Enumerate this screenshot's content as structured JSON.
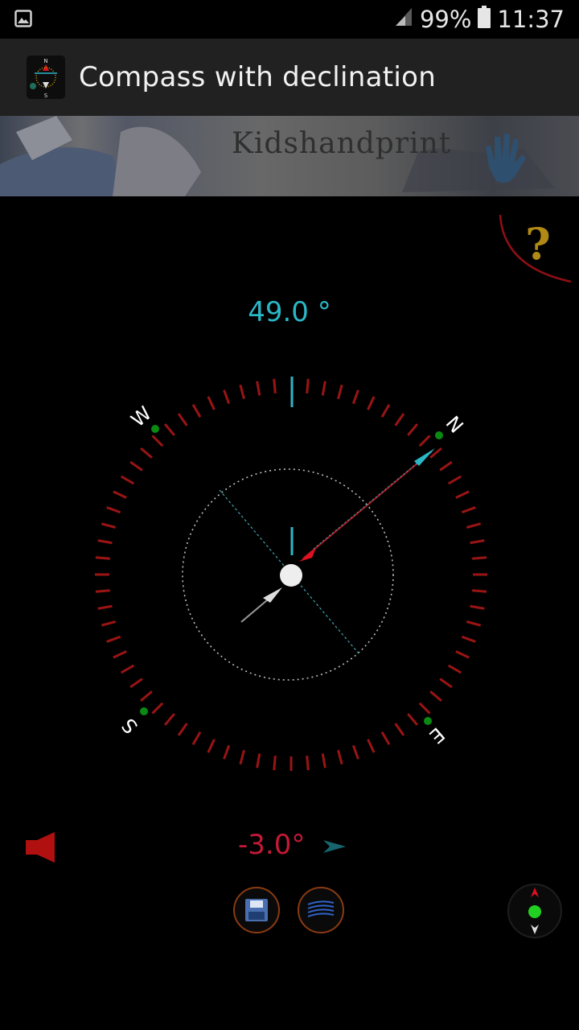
{
  "status_bar": {
    "battery": "99%",
    "time": "11:37",
    "icons": [
      "image-notification-icon",
      "signal-icon",
      "battery-icon"
    ]
  },
  "app_bar": {
    "title": "Compass with declination",
    "icon": "compass-app-icon"
  },
  "banner": {
    "text": "Kidshandprint"
  },
  "compass": {
    "heading": "49.0 °",
    "cardinals": {
      "n": "N",
      "e": "E",
      "s": "S",
      "w": "W"
    },
    "heading_value": 49.0
  },
  "declination": {
    "value_text": "-3.0°",
    "value": -3.0
  },
  "controls": {
    "help": "help-icon",
    "sound": "speaker-icon",
    "save": "save-icon",
    "layers": "layers-icon",
    "mini_compass": "mini-compass-icon",
    "arrow": "teal-arrow-icon"
  },
  "colors": {
    "accent_teal": "#2bb7c7",
    "needle_red": "#e01020",
    "tick_red": "#9a1414",
    "declination_red": "#c51937",
    "help_gold": "#b08a15"
  }
}
